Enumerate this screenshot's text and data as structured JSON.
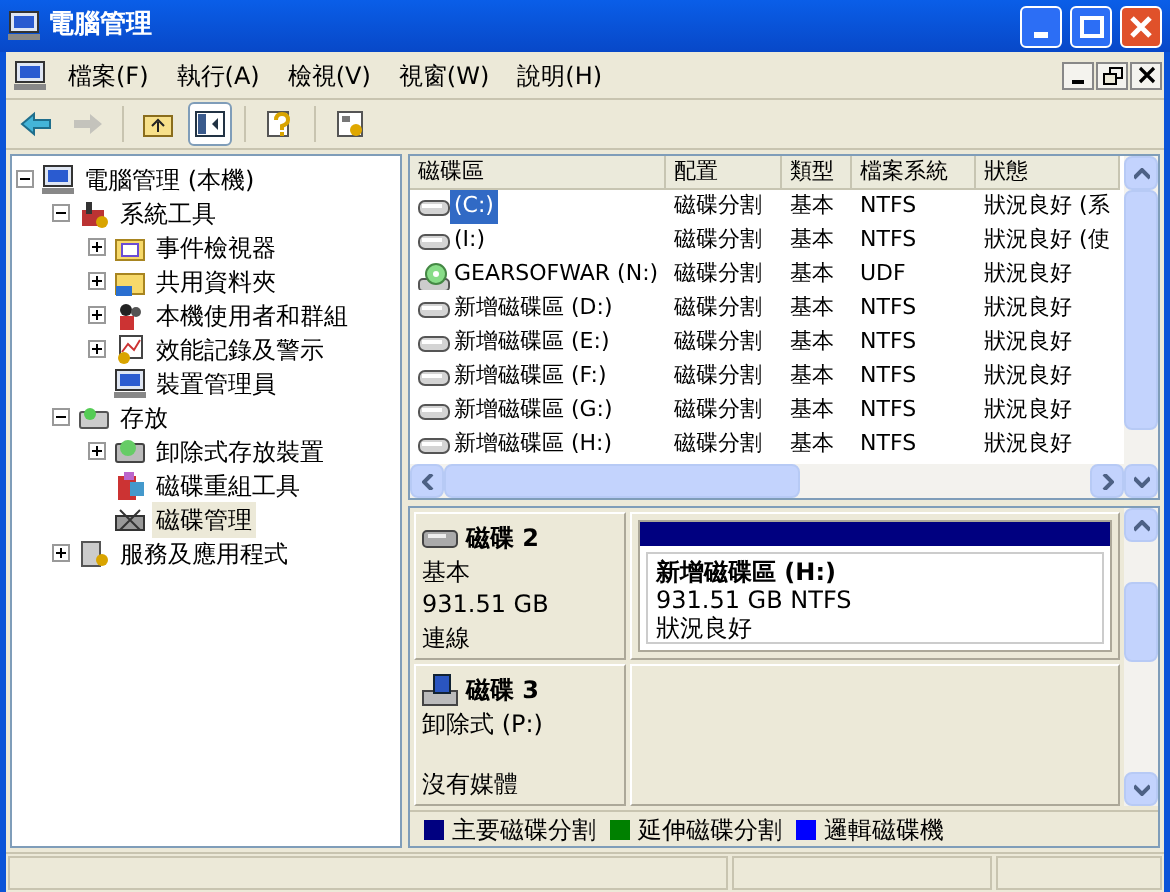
{
  "window": {
    "title": "電腦管理"
  },
  "menu": [
    "檔案(F)",
    "執行(A)",
    "檢視(V)",
    "視窗(W)",
    "說明(H)"
  ],
  "toolbar": [
    {
      "kind": "back",
      "disabled": false
    },
    {
      "kind": "forward",
      "disabled": true
    },
    {
      "kind": "up",
      "disabled": false
    },
    {
      "kind": "tree",
      "disabled": false,
      "selected": true
    },
    {
      "kind": "help",
      "disabled": false
    },
    {
      "kind": "props",
      "disabled": false
    }
  ],
  "tree": [
    {
      "label": "電腦管理 (本機)",
      "selected": false,
      "expanded": true,
      "children": [
        {
          "label": "系統工具",
          "selected": false,
          "expanded": true,
          "children": [
            {
              "label": "事件檢視器",
              "selected": false,
              "expanded": false
            },
            {
              "label": "共用資料夾",
              "selected": false,
              "expanded": false
            },
            {
              "label": "本機使用者和群組",
              "selected": false,
              "expanded": false
            },
            {
              "label": "效能記錄及警示",
              "selected": false,
              "expanded": false
            },
            {
              "label": "裝置管理員",
              "selected": false
            }
          ]
        },
        {
          "label": "存放",
          "selected": false,
          "expanded": true,
          "children": [
            {
              "label": "卸除式存放裝置",
              "selected": false,
              "expanded": false
            },
            {
              "label": "磁碟重組工具",
              "selected": false
            },
            {
              "label": "磁碟管理",
              "selected": true
            }
          ]
        },
        {
          "label": "服務及應用程式",
          "selected": false,
          "expanded": false
        }
      ]
    }
  ],
  "volumes": {
    "columns": [
      "磁碟區",
      "配置",
      "類型",
      "檔案系統",
      "狀態"
    ],
    "rows": [
      {
        "kind": "disk",
        "selected": true,
        "cells": [
          "(C:)",
          "磁碟分割",
          "基本",
          "NTFS",
          "狀況良好 (系"
        ]
      },
      {
        "kind": "disk",
        "selected": false,
        "cells": [
          "(I:)",
          "磁碟分割",
          "基本",
          "NTFS",
          "狀況良好 (使"
        ]
      },
      {
        "kind": "optical",
        "selected": false,
        "cells": [
          "GEARSOFWAR (N:)",
          "磁碟分割",
          "基本",
          "UDF",
          "狀況良好"
        ]
      },
      {
        "kind": "disk",
        "selected": false,
        "cells": [
          "新增磁碟區 (D:)",
          "磁碟分割",
          "基本",
          "NTFS",
          "狀況良好"
        ]
      },
      {
        "kind": "disk",
        "selected": false,
        "cells": [
          "新增磁碟區 (E:)",
          "磁碟分割",
          "基本",
          "NTFS",
          "狀況良好"
        ]
      },
      {
        "kind": "disk",
        "selected": false,
        "cells": [
          "新增磁碟區 (F:)",
          "磁碟分割",
          "基本",
          "NTFS",
          "狀況良好"
        ]
      },
      {
        "kind": "disk",
        "selected": false,
        "cells": [
          "新增磁碟區 (G:)",
          "磁碟分割",
          "基本",
          "NTFS",
          "狀況良好"
        ]
      },
      {
        "kind": "disk",
        "selected": false,
        "cells": [
          "新增磁碟區 (H:)",
          "磁碟分割",
          "基本",
          "NTFS",
          "狀況良好"
        ]
      }
    ]
  },
  "disks": [
    {
      "kind": "fixed",
      "name": "磁碟 2",
      "lines": [
        "基本",
        "931.51 GB",
        "連線"
      ],
      "partitions": [
        {
          "name": "新增磁碟區  (H:)",
          "size": "931.51 GB NTFS",
          "status": "狀況良好",
          "color": "#000080"
        }
      ]
    },
    {
      "kind": "removable",
      "name": "磁碟 3",
      "lines": [
        "卸除式 (P:)",
        "沒有媒體"
      ]
    }
  ],
  "legend": [
    {
      "label": "主要磁碟分割",
      "color": "#000080"
    },
    {
      "label": "延伸磁碟分割",
      "color": "#008000"
    },
    {
      "label": "邏輯磁碟機",
      "color": "#0000ff"
    }
  ]
}
